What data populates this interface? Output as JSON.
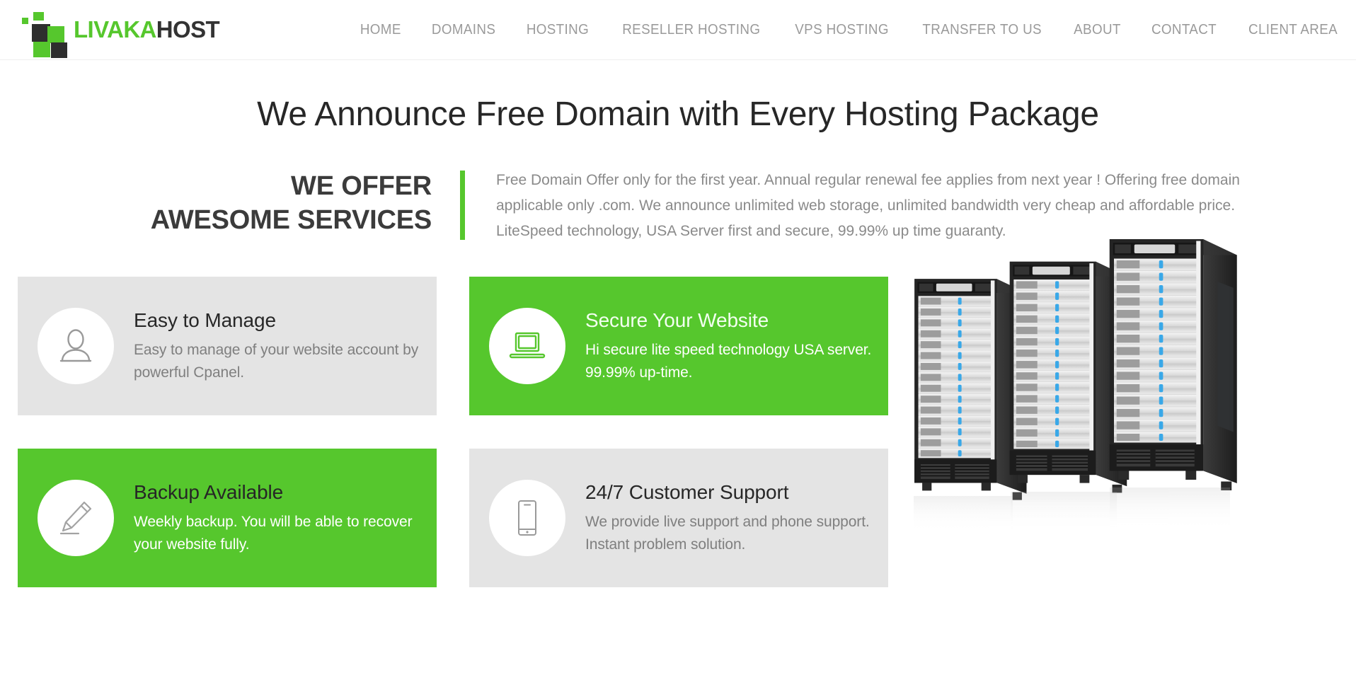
{
  "header": {
    "logo": {
      "mark_icon": "logo-squares-icon",
      "name_part_1": "LIVAKA",
      "name_part_2": "HOST",
      "green": "#56c72d",
      "dark": "#333333"
    },
    "nav": [
      {
        "label": "HOME",
        "name": "nav-home"
      },
      {
        "label": "DOMAINS",
        "name": "nav-domains"
      },
      {
        "label": "HOSTING",
        "name": "nav-hosting"
      },
      {
        "label": "RESELLER HOSTING",
        "name": "nav-reseller-hosting"
      },
      {
        "label": "VPS HOSTING",
        "name": "nav-vps-hosting"
      },
      {
        "label": "TRANSFER TO US",
        "name": "nav-transfer-to-us"
      },
      {
        "label": "ABOUT",
        "name": "nav-about"
      },
      {
        "label": "CONTACT",
        "name": "nav-contact"
      },
      {
        "label": "CLIENT AREA",
        "name": "nav-client-area"
      }
    ]
  },
  "page": {
    "title": "We Announce Free Domain with Every Hosting Package"
  },
  "intro": {
    "heading_line_1": "WE OFFER",
    "heading_line_2": "AWESOME SERVICES",
    "body": "Free Domain Offer only for the first year. Annual regular renewal fee applies from next year ! Offering free domain applicable only .com. We announce unlimited web storage, unlimited bandwidth very cheap and affordable price. LiteSpeed technology, USA Server first and secure, 99.99% up time guaranty.",
    "rule_color": "#56c72d"
  },
  "features": [
    {
      "title": "Easy to Manage",
      "desc": "Easy to manage of your website account by powerful Cpanel.",
      "icon": "user-icon",
      "theme": "gray",
      "bg": "#e4e4e4",
      "icon_color": "#9a9a9a"
    },
    {
      "title": "Secure Your Website",
      "desc": "Hi secure lite speed technology USA server. 99.99% up-time.",
      "icon": "laptop-icon",
      "theme": "green",
      "bg": "#56c72d",
      "icon_color": "#56c72d"
    },
    {
      "title": "Backup Available",
      "desc": "Weekly backup. You will be able to recover your website fully.",
      "icon": "pencil-icon",
      "theme": "green",
      "bg": "#56c72d",
      "icon_color": "#9a9a9a"
    },
    {
      "title": "24/7 Customer Support",
      "desc": "We provide live support and phone support. Instant problem solution.",
      "icon": "mobile-phone-icon",
      "theme": "gray",
      "bg": "#e4e4e4",
      "icon_color": "#9a9a9a"
    }
  ],
  "illustration": {
    "name": "server-racks-image",
    "alt": "Three black server racks with blue drive indicator lights and a floor reflection",
    "rack_count": 3,
    "led_color": "#3aa9e8"
  }
}
